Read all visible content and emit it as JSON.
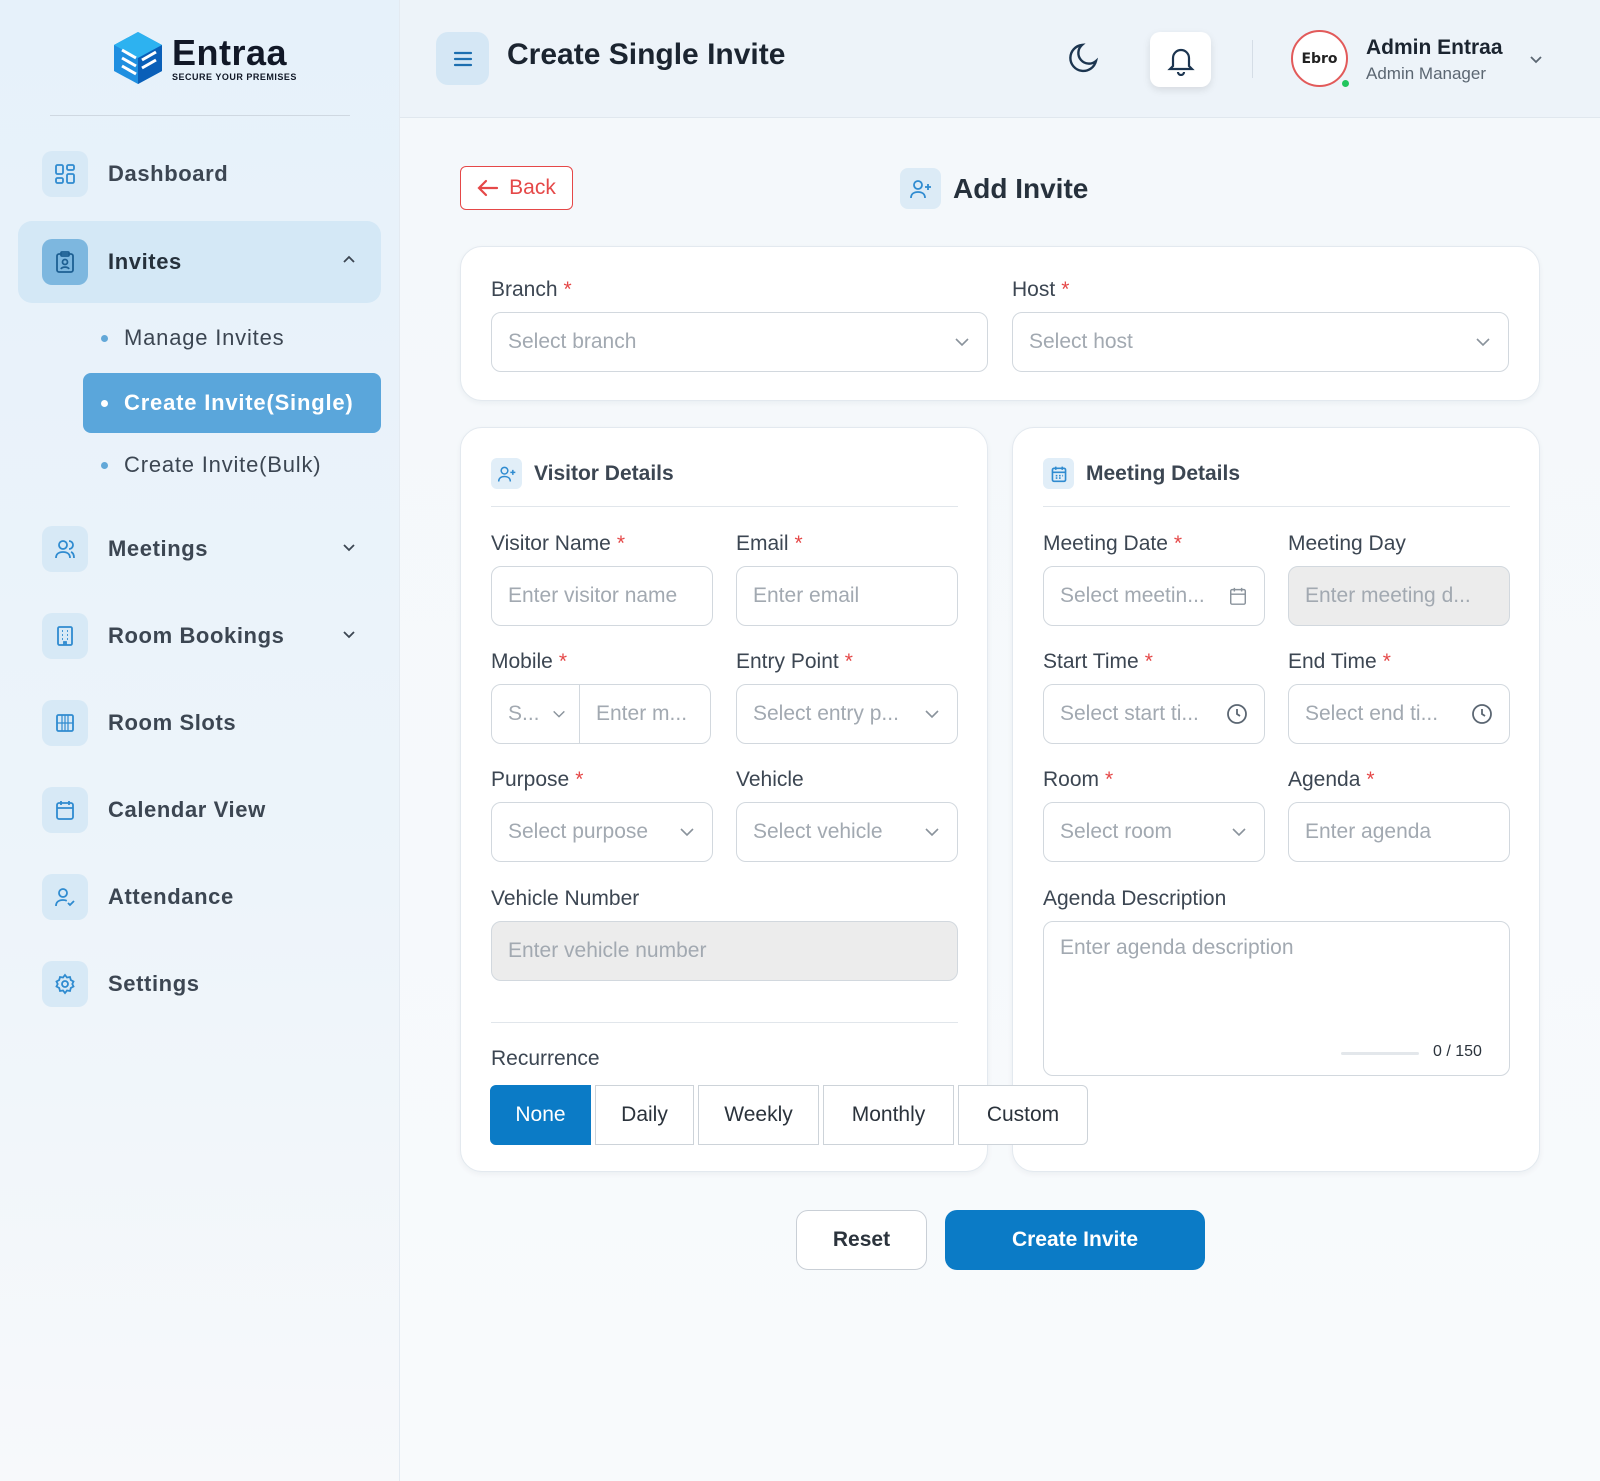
{
  "brand": {
    "name": "Entraa",
    "tagline": "SECURE YOUR PREMISES"
  },
  "header": {
    "title": "Create Single Invite",
    "user": {
      "name": "Admin Entraa",
      "role": "Admin Manager",
      "avatar_text": "Ebro"
    }
  },
  "sidebar": {
    "items": [
      {
        "label": "Dashboard",
        "icon": "dashboard-icon"
      },
      {
        "label": "Invites",
        "icon": "clipboard-icon",
        "expanded": true
      },
      {
        "label": "Meetings",
        "icon": "users-icon"
      },
      {
        "label": "Room Bookings",
        "icon": "building-icon"
      },
      {
        "label": "Room Slots",
        "icon": "grid-icon"
      },
      {
        "label": "Calendar View",
        "icon": "calendar-icon"
      },
      {
        "label": "Attendance",
        "icon": "user-check-icon"
      },
      {
        "label": "Settings",
        "icon": "gear-icon"
      }
    ],
    "invites_sub": [
      {
        "label": "Manage Invites"
      },
      {
        "label": "Create Invite(Single)",
        "active": true
      },
      {
        "label": "Create Invite(Bulk)"
      }
    ]
  },
  "page": {
    "back_label": "Back",
    "heading": "Add Invite"
  },
  "top_card": {
    "branch": {
      "label": "Branch",
      "placeholder": "Select branch"
    },
    "host": {
      "label": "Host",
      "placeholder": "Select host"
    }
  },
  "visitor": {
    "title": "Visitor Details",
    "name": {
      "label": "Visitor Name",
      "placeholder": "Enter visitor name"
    },
    "email": {
      "label": "Email",
      "placeholder": "Enter email"
    },
    "mobile": {
      "label": "Mobile",
      "code_placeholder": "S...",
      "placeholder": "Enter m..."
    },
    "entry_point": {
      "label": "Entry Point",
      "placeholder": "Select entry p..."
    },
    "purpose": {
      "label": "Purpose",
      "placeholder": "Select purpose"
    },
    "vehicle": {
      "label": "Vehicle",
      "placeholder": "Select vehicle"
    },
    "vehicle_number": {
      "label": "Vehicle Number",
      "placeholder": "Enter vehicle number"
    },
    "recurrence": {
      "label": "Recurrence",
      "options": [
        "None",
        "Daily",
        "Weekly",
        "Monthly",
        "Custom"
      ],
      "selected": "None"
    }
  },
  "meeting": {
    "title": "Meeting Details",
    "date": {
      "label": "Meeting Date",
      "placeholder": "Select meetin..."
    },
    "day": {
      "label": "Meeting Day",
      "placeholder": "Enter meeting d..."
    },
    "start": {
      "label": "Start Time",
      "placeholder": "Select start ti..."
    },
    "end": {
      "label": "End Time",
      "placeholder": "Select end ti..."
    },
    "room": {
      "label": "Room",
      "placeholder": "Select room"
    },
    "agenda": {
      "label": "Agenda",
      "placeholder": "Enter agenda"
    },
    "agenda_desc": {
      "label": "Agenda Description",
      "placeholder": "Enter agenda description",
      "counter": "0 / 150"
    }
  },
  "actions": {
    "reset": "Reset",
    "create": "Create Invite"
  },
  "colors": {
    "primary": "#0b7bc6",
    "danger": "#e54848",
    "sidebar_active": "#5aa6db"
  }
}
